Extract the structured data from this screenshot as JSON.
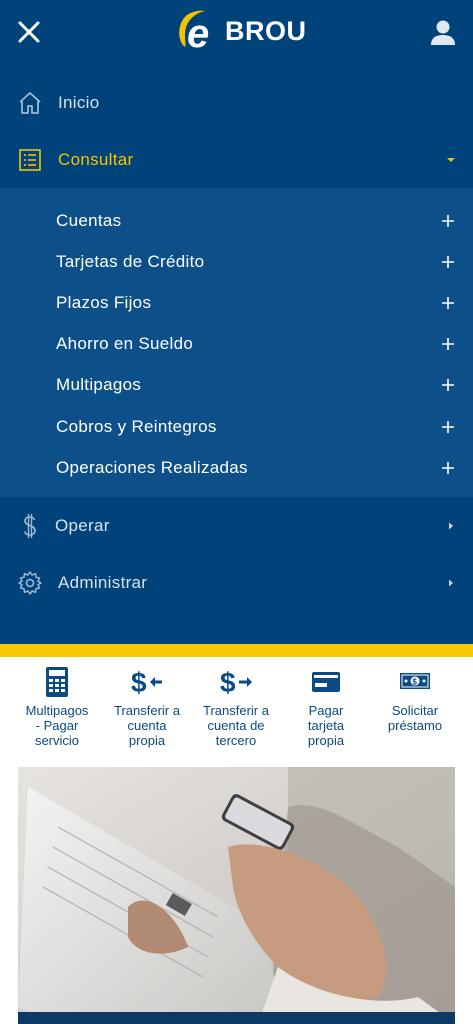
{
  "header": {
    "logo_letter": "e",
    "logo_text": "BROU",
    "close_icon": "close-icon",
    "user_icon": "user-icon"
  },
  "menu": {
    "items": [
      {
        "label": "Inicio",
        "icon": "home-icon"
      },
      {
        "label": "Consultar",
        "icon": "list-icon",
        "active": true
      },
      {
        "label": "Operar",
        "icon": "dollar-icon"
      },
      {
        "label": "Administrar",
        "icon": "gear-icon"
      }
    ],
    "consultar_sub": [
      {
        "label": "Cuentas"
      },
      {
        "label": "Tarjetas de Crédito"
      },
      {
        "label": "Plazos Fijos"
      },
      {
        "label": "Ahorro en Sueldo"
      },
      {
        "label": "Multipagos"
      },
      {
        "label": "Cobros y Reintegros"
      },
      {
        "label": "Operaciones Realizadas"
      }
    ]
  },
  "quick_actions": [
    {
      "label_l1": "Multipagos",
      "label_l2": "- Pagar",
      "label_l3": "servicio",
      "icon": "calculator-icon"
    },
    {
      "label_l1": "Transferir a",
      "label_l2": "cuenta",
      "label_l3": "propia",
      "icon": "transfer-own-icon"
    },
    {
      "label_l1": "Transferir a",
      "label_l2": "cuenta de",
      "label_l3": "tercero",
      "icon": "transfer-third-icon"
    },
    {
      "label_l1": "Pagar",
      "label_l2": "tarjeta",
      "label_l3": "propia",
      "icon": "credit-card-icon"
    },
    {
      "label_l1": "Solicitar",
      "label_l2": "préstamo",
      "label_l3": "",
      "icon": "banknote-icon"
    }
  ],
  "colors": {
    "primary": "#00437a",
    "submenu": "#0d5089",
    "accent": "#f5c400",
    "link": "#0a4a85"
  }
}
